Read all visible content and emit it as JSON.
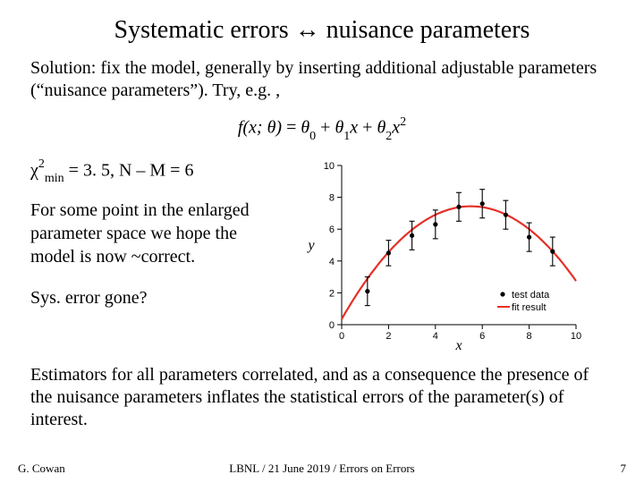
{
  "title": "Systematic errors ↔ nuisance parameters",
  "intro": "Solution: fix the model, generally by inserting additional adjustable parameters (“nuisance parameters”).  Try, e.g. ,",
  "equation": {
    "lhs_f": "f",
    "lhs_args": "(x; θ)",
    "eq": " = ",
    "t0": "θ",
    "s0": "0",
    "plus1": " + ",
    "t1": "θ",
    "s1": "1",
    "x1": "x",
    "plus2": " + ",
    "t2": "θ",
    "s2": "2",
    "x2": "x",
    "p2": "2"
  },
  "chi": {
    "chi": "χ",
    "sq": "2",
    "min": "min",
    "rest": "  = 3. 5, N – M = 6"
  },
  "para": "For some point in the enlarged parameter space we hope the model is now ~correct.",
  "sysq": "Sys. error gone?",
  "outro": "Estimators for all parameters correlated, and as a consequence the presence of the nuisance parameters inflates the statistical errors of the parameter(s) of interest.",
  "footer": {
    "left": "G. Cowan",
    "center": "LBNL / 21 June 2019 / Errors on Errors",
    "right": "7"
  },
  "legend": {
    "data": "test data",
    "fit": "fit result"
  },
  "axes": {
    "x": "x",
    "y": "y"
  },
  "chart_data": {
    "type": "scatter+line",
    "title": "",
    "xlabel": "x",
    "ylabel": "y",
    "xlim": [
      0,
      10
    ],
    "ylim": [
      0,
      10
    ],
    "xticks": [
      0,
      2,
      4,
      6,
      8,
      10
    ],
    "yticks": [
      0,
      2,
      4,
      6,
      8,
      10
    ],
    "series": [
      {
        "name": "fit result",
        "role": "fit",
        "kind": "curve",
        "coeffs_note": "quadratic f(x)=theta0+theta1*x+theta2*x^2, approx",
        "theta": [
          0.35,
          2.57,
          -0.233
        ]
      },
      {
        "name": "test data",
        "role": "data",
        "kind": "points-with-yerrors",
        "x": [
          1.1,
          2.0,
          3.0,
          4.0,
          5.0,
          6.0,
          7.0,
          8.0,
          9.0
        ],
        "y": [
          2.1,
          4.5,
          5.6,
          6.3,
          7.4,
          7.6,
          6.9,
          5.5,
          4.6
        ],
        "yerr": [
          0.9,
          0.8,
          0.9,
          0.9,
          0.9,
          0.9,
          0.9,
          0.9,
          0.9
        ]
      }
    ],
    "legend_position": "bottom-right"
  }
}
